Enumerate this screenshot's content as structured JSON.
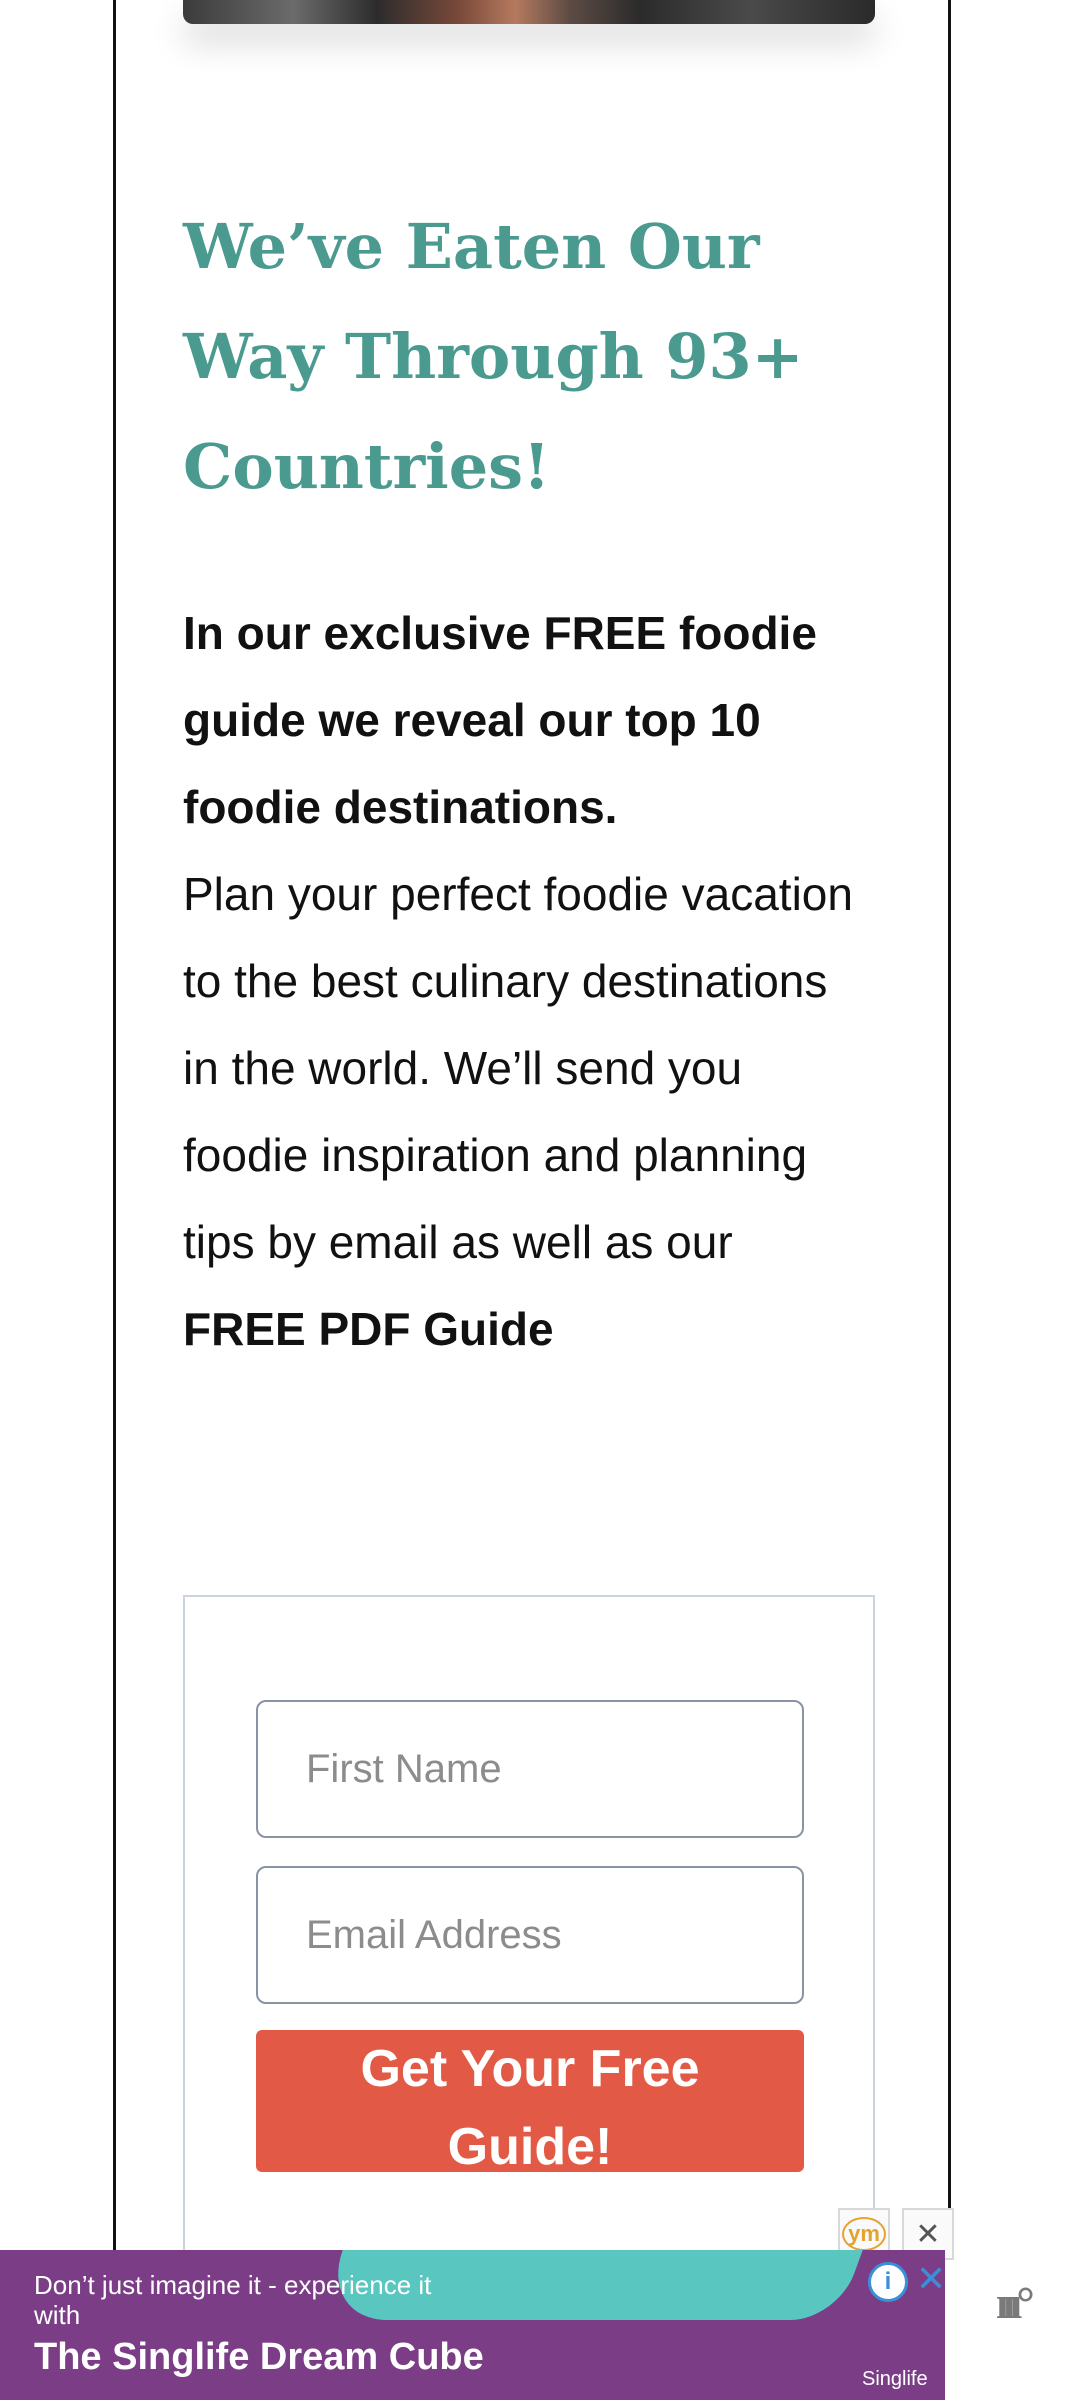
{
  "headline": "We’ve Eaten Our Way Through 93+ Countries!",
  "intro_bold": "In our exclusive FREE foodie guide we reveal our top 10 foodie destinations.",
  "body_text": "Plan your perfect foodie vacation to the best culinary destinations in the world. We’ll send you foodie inspiration and planning tips by email as well as our ",
  "body_bold_end": "FREE PDF Guide",
  "form": {
    "first_name_placeholder": "First Name",
    "email_placeholder": "Email Address",
    "submit_label": "Get Your Free Guide!"
  },
  "ad": {
    "line1": "Don’t just imagine it - experience it with",
    "line2": "The Singlife Dream Cube",
    "brand": "Singlife",
    "info_icon": "i",
    "close_icon": "✕",
    "badge": "ym"
  },
  "side_logo": "ııı°",
  "colors": {
    "headline": "#4a9a8f",
    "cta": "#e25a45",
    "ad_bg": "#7b3e86",
    "ad_accent": "#59c6bf"
  }
}
